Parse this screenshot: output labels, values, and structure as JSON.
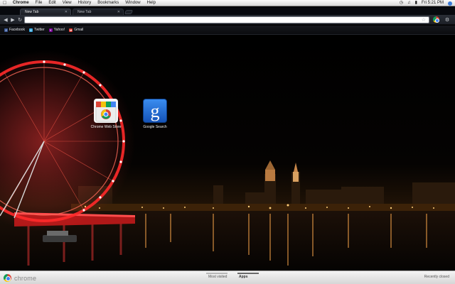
{
  "menubar": {
    "apple_glyph": "",
    "items": [
      "Chrome",
      "File",
      "Edit",
      "View",
      "History",
      "Bookmarks",
      "Window",
      "Help"
    ],
    "clock": "Fri 5:21 PM"
  },
  "tabs": [
    {
      "label": "New Tab",
      "active": true
    },
    {
      "label": "New Tab",
      "active": false
    }
  ],
  "toolbar": {
    "back_icon": "back-arrow-icon",
    "forward_icon": "forward-arrow-icon",
    "reload_icon": "reload-icon",
    "url_value": "",
    "bookmark_star_icon": "star-icon",
    "wrench_icon": "wrench-icon"
  },
  "bookmarks": [
    {
      "label": "Facebook",
      "color": "#3b5998",
      "glyph": "f"
    },
    {
      "label": "Twitter",
      "color": "#3aa9e0",
      "glyph": "t"
    },
    {
      "label": "Yahoo!",
      "color": "#7b0099",
      "glyph": "Y"
    },
    {
      "label": "Gmail",
      "color": "#d93025",
      "glyph": "M"
    }
  ],
  "apps": [
    {
      "label": "Chrome Web Store"
    },
    {
      "label": "Google Search"
    }
  ],
  "bottom": {
    "brand": "chrome",
    "most_visited": "Most visited",
    "apps": "Apps",
    "recently_closed": "Recently closed"
  },
  "colors": {
    "ferris_wheel": "#ff2a2a",
    "river_light": "#ffb347",
    "background": "#000000"
  }
}
